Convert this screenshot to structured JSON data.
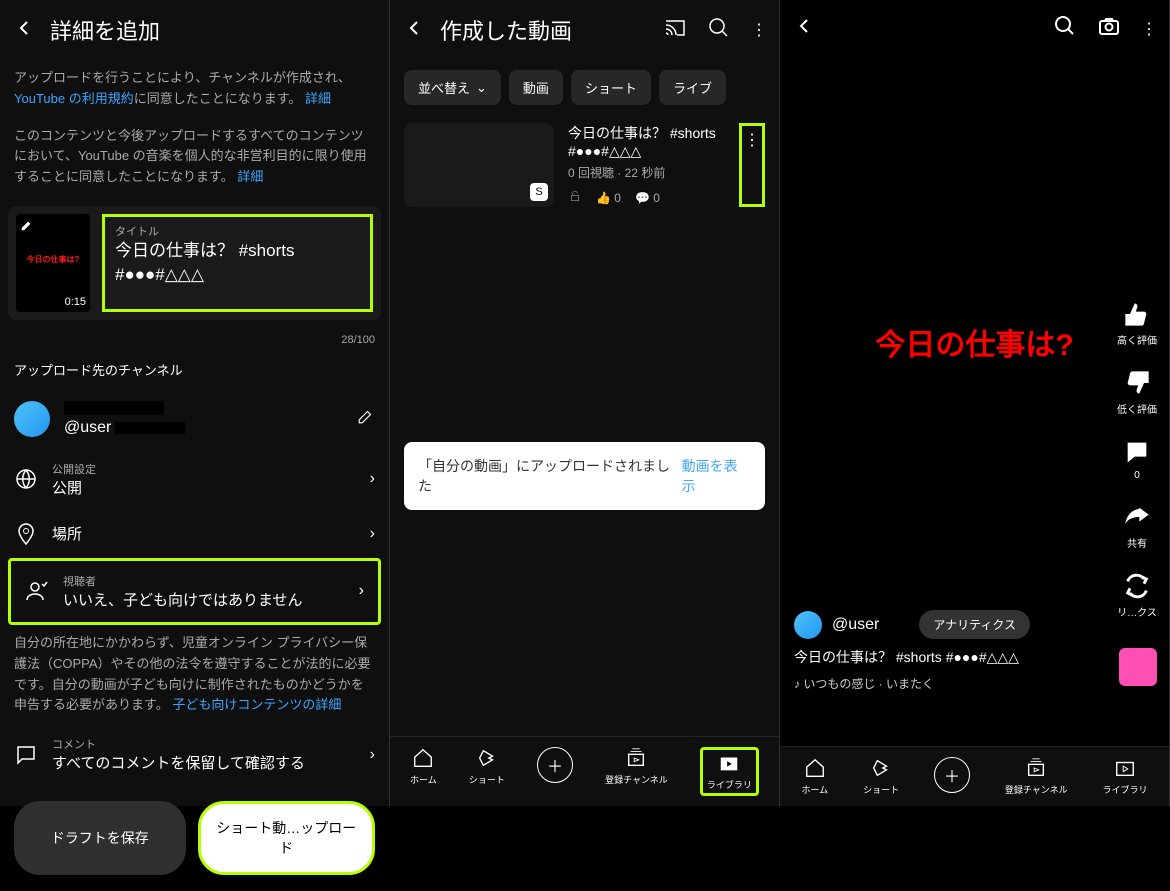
{
  "panel1": {
    "title": "詳細を追加",
    "notice1_pre": "アップロードを行うことにより、チャンネルが作成され、",
    "notice1_link": "YouTube の利用規約",
    "notice1_post": "に同意したことになります。",
    "notice1_more": "詳細",
    "notice2": "このコンテンツと今後アップロードするすべてのコンテンツにおいて、YouTube の音楽を個人的な非営利目的に限り使用することに同意したことになります。",
    "notice2_more": "詳細",
    "thumb_text": "今日の仕事は?",
    "thumb_time": "0:15",
    "title_label": "タイトル",
    "video_title": "今日の仕事は？ #shorts #●●●#△△△",
    "counter": "28/100",
    "upload_to": "アップロード先のチャンネル",
    "user": "@user",
    "visibility_label": "公開設定",
    "visibility_value": "公開",
    "location": "場所",
    "audience_label": "視聴者",
    "audience_value": "いいえ、子ども向けではありません",
    "coppa": "自分の所在地にかかわらず、児童オンライン プライバシー保護法（COPPA）やその他の法令を遵守することが法的に必要です。自分の動画が子ども向けに制作されたものかどうかを申告する必要があります。",
    "coppa_link": "子ども向けコンテンツの詳細",
    "comment_label": "コメント",
    "comment_value": "すべてのコメントを保留して確認する",
    "btn_draft": "ドラフトを保存",
    "btn_upload": "ショート動…ップロード"
  },
  "panel2": {
    "title": "作成した動画",
    "sort": "並べ替え",
    "tab_video": "動画",
    "tab_shorts": "ショート",
    "tab_live": "ライブ",
    "video_title": "今日の仕事は？ #shorts #●●●#△△△",
    "video_meta": "0 回視聴 · 22 秒前",
    "like_count": "0",
    "comment_count": "0",
    "toast_msg": "「自分の動画」にアップロードされました",
    "toast_action": "動画を表示",
    "nav": {
      "home": "ホーム",
      "shorts": "ショート",
      "subs": "登録チャンネル",
      "lib": "ライブラリ"
    }
  },
  "panel3": {
    "overlay": "今日の仕事は?",
    "like": "高く評価",
    "dislike": "低く評価",
    "comments": "0",
    "share": "共有",
    "remix": "リ…クス",
    "user": "@user",
    "analytics": "アナリティクス",
    "caption": "今日の仕事は？ #shorts #●●●#△△△",
    "music": "いつもの感じ · いまたく",
    "nav": {
      "home": "ホーム",
      "shorts": "ショート",
      "subs": "登録チャンネル",
      "lib": "ライブラリ"
    }
  }
}
